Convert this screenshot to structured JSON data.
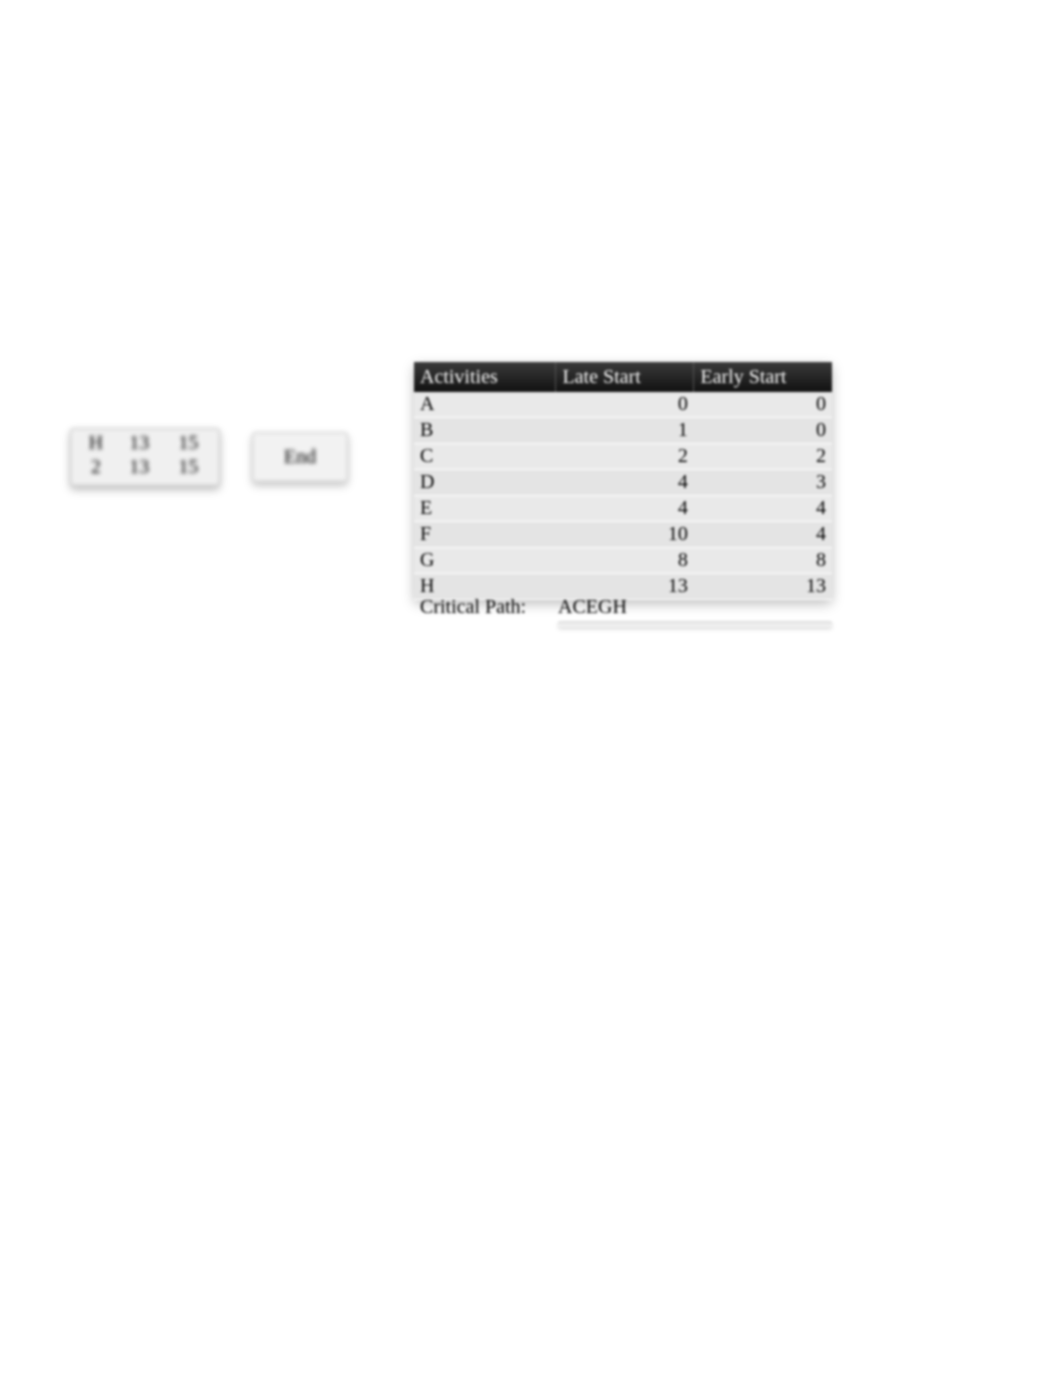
{
  "node": {
    "row1": {
      "c1": "H",
      "c2": "13",
      "c3": "15"
    },
    "row2": {
      "c1": "2",
      "c2": "13",
      "c3": "15"
    }
  },
  "end_box": {
    "label": "End"
  },
  "table": {
    "headers": {
      "activities": "Activities",
      "late_start": "Late Start",
      "early_start": "Early Start"
    },
    "rows": [
      {
        "activity": "A",
        "late_start": "0",
        "early_start": "0"
      },
      {
        "activity": "B",
        "late_start": "1",
        "early_start": "0"
      },
      {
        "activity": "C",
        "late_start": "2",
        "early_start": "2"
      },
      {
        "activity": "D",
        "late_start": "4",
        "early_start": "3"
      },
      {
        "activity": "E",
        "late_start": "4",
        "early_start": "4"
      },
      {
        "activity": "F",
        "late_start": "10",
        "early_start": "4"
      },
      {
        "activity": "G",
        "late_start": "8",
        "early_start": "8"
      },
      {
        "activity": "H",
        "late_start": "13",
        "early_start": "13"
      }
    ]
  },
  "critical_path": {
    "label": "Critical Path:",
    "value": "ACEGH"
  }
}
